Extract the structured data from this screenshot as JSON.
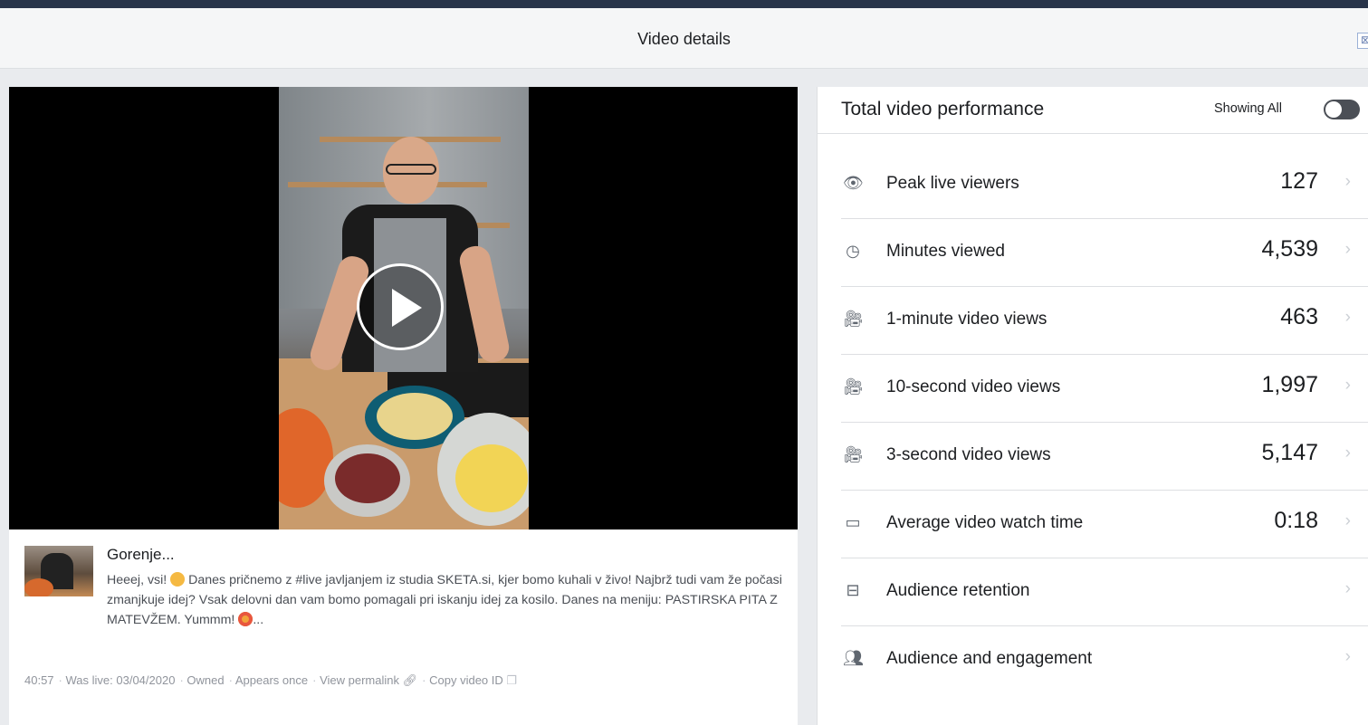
{
  "header": {
    "title": "Video details",
    "close_glyph": "⊠"
  },
  "video": {
    "play_icon": "play-icon"
  },
  "post": {
    "title": "Gorenje...",
    "desc_1": "Heeej, vsi!",
    "desc_2": "Danes pričnemo z #live javljanjem iz studia SKETA.si, kjer bomo kuhali v živo! Najbrž tudi vam že počasi zmanjkuje idej? Vsak delovni dan vam bomo pomagali pri iskanju idej za kosilo. Danes na meniju: PASTIRSKA PITA Z MATEVŽEM. Yummm!",
    "desc_ellipsis": "...",
    "meta": {
      "duration": "40:57",
      "was_live": "Was live: 03/04/2020",
      "owned": "Owned",
      "appears": "Appears once",
      "permalink": "View permalink",
      "copy_id": "Copy video ID"
    }
  },
  "performance": {
    "title": "Total video performance",
    "toggle_label": "Showing All",
    "toggle_on": false,
    "metrics": [
      {
        "icon": "eye-icon",
        "label": "Peak live viewers",
        "value": "127"
      },
      {
        "icon": "clock-icon",
        "label": "Minutes viewed",
        "value": "4,539"
      },
      {
        "icon": "video-camera-icon",
        "label": "1-minute video views",
        "value": "463"
      },
      {
        "icon": "video-camera-icon",
        "label": "10-second video views",
        "value": "1,997"
      },
      {
        "icon": "video-camera-icon",
        "label": "3-second video views",
        "value": "5,147"
      },
      {
        "icon": "video-outline-icon",
        "label": "Average video watch time",
        "value": "0:18"
      },
      {
        "icon": "film-strip-icon",
        "label": "Audience retention",
        "value": ""
      },
      {
        "icon": "people-icon",
        "label": "Audience and engagement",
        "value": ""
      }
    ]
  }
}
